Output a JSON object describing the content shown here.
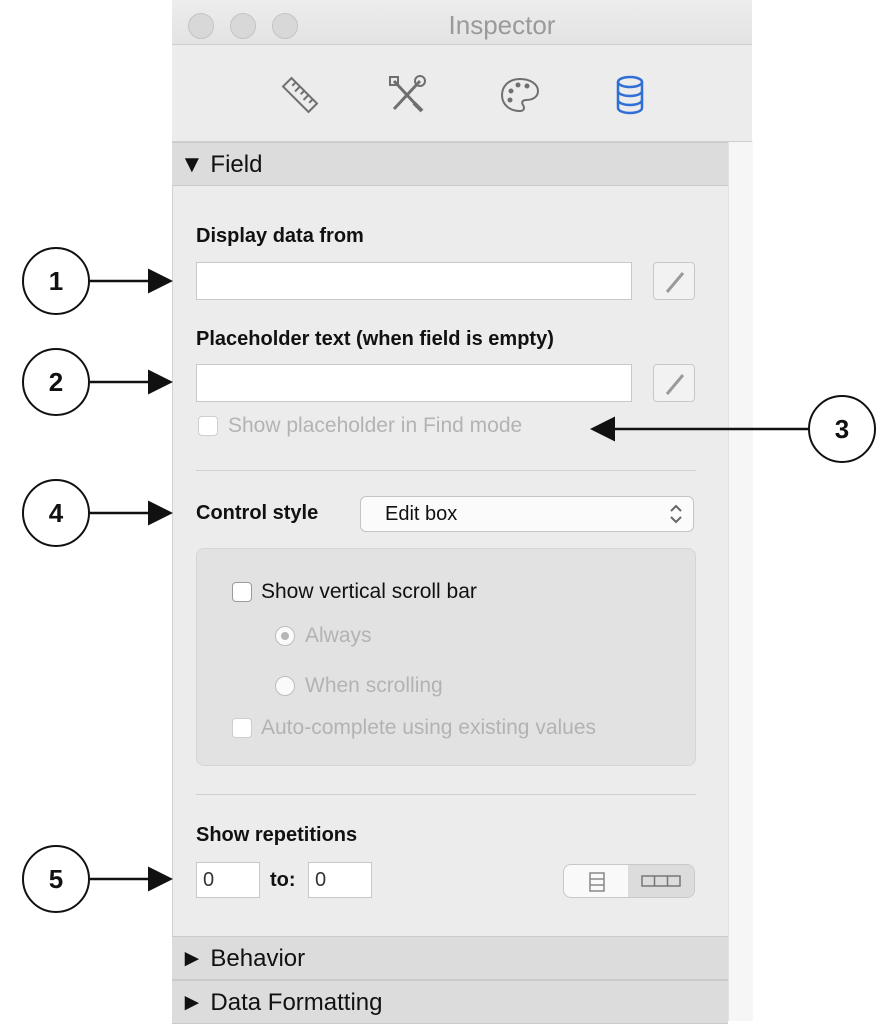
{
  "window": {
    "title": "Inspector"
  },
  "toolbar": {
    "tabs": [
      {
        "icon": "ruler-icon"
      },
      {
        "icon": "tools-icon"
      },
      {
        "icon": "palette-icon"
      },
      {
        "icon": "database-icon",
        "selected": true
      }
    ],
    "selected_color": "#2f6fd6"
  },
  "field_section": {
    "header": "▼ Field",
    "display_data_from": {
      "label": "Display data from",
      "value": ""
    },
    "placeholder_text": {
      "label": "Placeholder text (when field is empty)",
      "value": ""
    },
    "show_placeholder_find": {
      "label": "Show placeholder in Find mode",
      "checked": false,
      "disabled": true
    },
    "control_style": {
      "label": "Control style",
      "selected": "Edit box"
    },
    "show_vertical_scroll_bar": {
      "label": "Show vertical scroll bar",
      "checked": false
    },
    "scroll_always": {
      "label": "Always",
      "selected": true,
      "disabled": true
    },
    "scroll_when_scrolling": {
      "label": "When scrolling",
      "selected": false,
      "disabled": true
    },
    "auto_complete": {
      "label": "Auto-complete using existing values",
      "checked": false,
      "disabled": true
    },
    "show_repetitions": {
      "label": "Show repetitions",
      "from": "0",
      "to_label": "to:",
      "to": "0"
    }
  },
  "collapsed_sections": {
    "behavior": "► Behavior",
    "data_formatting": "► Data Formatting"
  },
  "callouts": [
    "1",
    "2",
    "3",
    "4",
    "5"
  ]
}
